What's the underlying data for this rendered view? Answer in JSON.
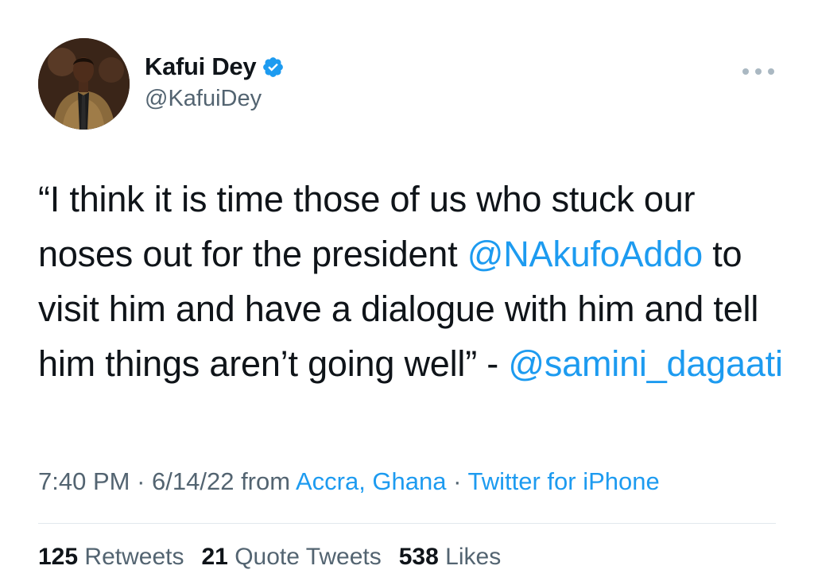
{
  "author": {
    "display_name": "Kafui Dey",
    "handle": "@KafuiDey",
    "verified": true
  },
  "tweet": {
    "text_segments": [
      {
        "text": "“I think it is time those of us who stuck our noses out for the president ",
        "type": "text"
      },
      {
        "text": "@NAkufoAddo",
        "type": "mention"
      },
      {
        "text": " to visit him and have a dialogue with him and tell him things aren’t going well” - ",
        "type": "text"
      },
      {
        "text": "@samini_dagaati",
        "type": "mention"
      }
    ]
  },
  "meta": {
    "time": "7:40 PM",
    "separator": " · ",
    "date": "6/14/22",
    "from_label": " from ",
    "location": "Accra, Ghana",
    "source": "Twitter for iPhone"
  },
  "stats": {
    "retweets_count": "125",
    "retweets_label": "Retweets",
    "quotes_count": "21",
    "quotes_label": "Quote Tweets",
    "likes_count": "538",
    "likes_label": "Likes"
  },
  "colors": {
    "accent": "#1d9bf0",
    "secondary_text": "#536471",
    "primary_text": "#0f1419"
  },
  "icons": {
    "verified": "verified-badge-icon",
    "more": "more-dots-icon"
  }
}
